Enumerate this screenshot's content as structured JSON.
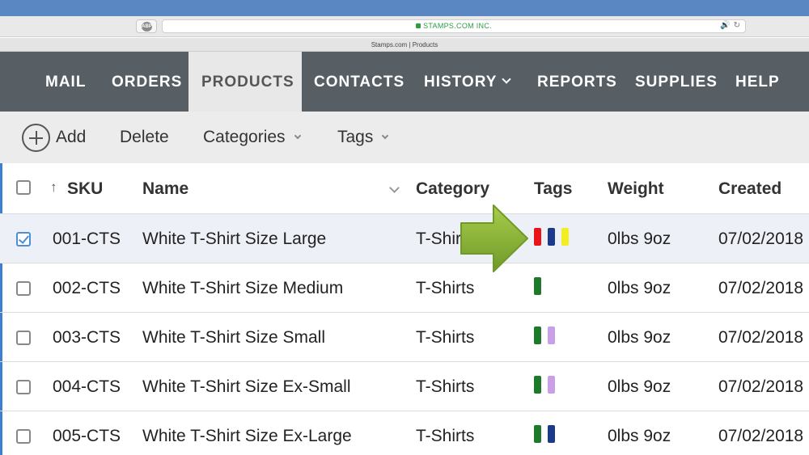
{
  "browser": {
    "url": "STAMPS.COM INC.",
    "tab_title": "Stamps.com | Products",
    "adblock": "ABP",
    "speaker_icon": "speaker-icon",
    "reload_icon": "reload-icon"
  },
  "nav": {
    "items": [
      {
        "label": "MAIL"
      },
      {
        "label": "ORDERS"
      },
      {
        "label": "PRODUCTS",
        "active": true
      },
      {
        "label": "CONTACTS"
      },
      {
        "label": "HISTORY"
      },
      {
        "label": "REPORTS"
      },
      {
        "label": "SUPPLIES"
      },
      {
        "label": "HELP"
      }
    ]
  },
  "toolbar": {
    "add": "Add",
    "delete": "Delete",
    "categories": "Categories",
    "tags": "Tags"
  },
  "table": {
    "headers": {
      "sku": "SKU",
      "name": "Name",
      "category": "Category",
      "tags": "Tags",
      "weight": "Weight",
      "created": "Created"
    },
    "rows": [
      {
        "sku": "001-CTS",
        "name": "White T-Shirt Size Large",
        "category": "T-Shirts",
        "tags": [
          "#e8141a",
          "#1c3a8a",
          "#f2ee22"
        ],
        "weight": "0lbs 9oz",
        "created": "07/02/2018",
        "checked": true
      },
      {
        "sku": "002-CTS",
        "name": "White T-Shirt Size Medium",
        "category": "T-Shirts",
        "tags": [
          "#1d7a2a"
        ],
        "weight": "0lbs 9oz",
        "created": "07/02/2018",
        "checked": false
      },
      {
        "sku": "003-CTS",
        "name": "White T-Shirt Size Small",
        "category": "T-Shirts",
        "tags": [
          "#1d7a2a",
          "#c9a0e8"
        ],
        "weight": "0lbs 9oz",
        "created": "07/02/2018",
        "checked": false
      },
      {
        "sku": "004-CTS",
        "name": "White T-Shirt Size Ex-Small",
        "category": "T-Shirts",
        "tags": [
          "#1d7a2a",
          "#c9a0e8"
        ],
        "weight": "0lbs 9oz",
        "created": "07/02/2018",
        "checked": false
      },
      {
        "sku": "005-CTS",
        "name": "White T-Shirt Size Ex-Large",
        "category": "T-Shirts",
        "tags": [
          "#1d7a2a",
          "#1c3a8a"
        ],
        "weight": "0lbs 9oz",
        "created": "07/02/2018",
        "checked": false
      }
    ]
  },
  "colors": {
    "nav_bg": "#575f64",
    "active_tab_bg": "#e8e8e8",
    "selection_accent": "#3d7fd0",
    "callout_arrow": "#8db33a"
  }
}
